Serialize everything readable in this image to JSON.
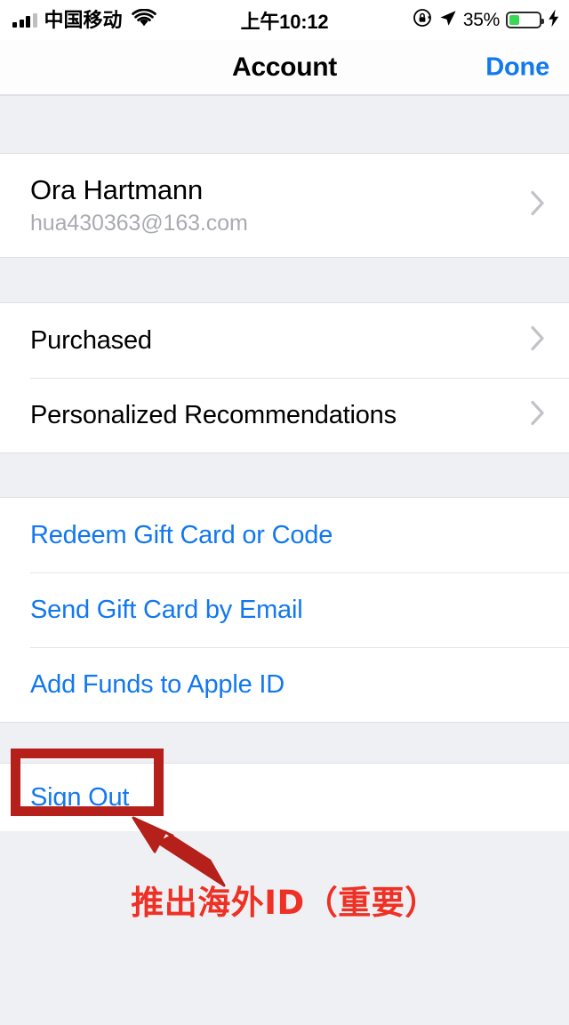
{
  "status_bar": {
    "carrier": "中国移动",
    "signal_icon": "signal-bars-icon",
    "wifi_icon": "wifi-icon",
    "time": "上午10:12",
    "rotation_lock_icon": "rotation-lock-icon",
    "location_icon": "location-arrow-icon",
    "battery_percent": "35%",
    "battery_level": 35,
    "battery_icon": "battery-icon",
    "charging_icon": "lightning-bolt-icon",
    "colors": {
      "battery_fill": "#3bd755"
    }
  },
  "navbar": {
    "title": "Account",
    "done_label": "Done",
    "accent_color": "#1278ef"
  },
  "sections": {
    "account": {
      "name": "Ora Hartmann",
      "email": "hua430363@163.com",
      "chevron_icon": "chevron-right-icon"
    },
    "library": {
      "rows": [
        {
          "label": "Purchased",
          "chevron_icon": "chevron-right-icon"
        },
        {
          "label": "Personalized Recommendations",
          "chevron_icon": "chevron-right-icon"
        }
      ]
    },
    "gift": {
      "rows": [
        {
          "label": "Redeem Gift Card or Code"
        },
        {
          "label": "Send Gift Card by Email"
        },
        {
          "label": "Add Funds to Apple ID"
        }
      ]
    },
    "signout": {
      "label": "Sign Out"
    }
  },
  "annotation": {
    "highlight_target": "Sign Out",
    "caption": "推出海外ID（重要）",
    "box_color": "#b5201a",
    "arrow_color": "#b5201a",
    "caption_color": "#ee3124",
    "arrow_icon": "arrow-up-left-icon"
  }
}
